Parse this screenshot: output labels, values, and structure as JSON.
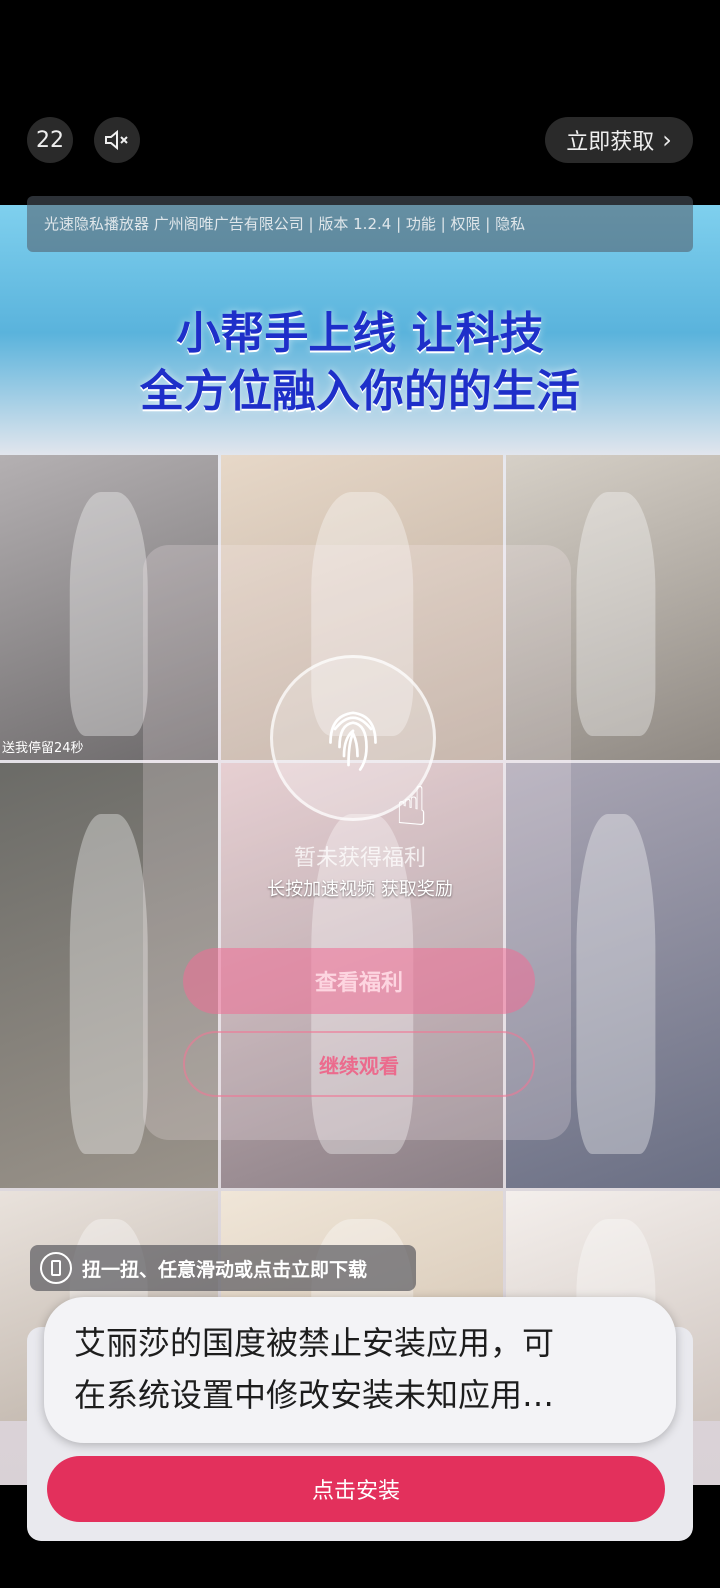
{
  "topbar": {
    "countdown": "22",
    "get_now_label": "立即获取",
    "get_now_chevron": "›"
  },
  "info_bar": {
    "text": "光速隐私播放器 广州阁唯广告有限公司 | 版本 1.2.4 | 功能 | 权限 | 隐私"
  },
  "ad": {
    "headline_line1": "小帮手上线 让科技",
    "headline_line2": "全方位融入你的的生活",
    "cell_caption": "送我停留24秒",
    "overlay_status": "暂未获得福利",
    "overlay_hint": "长按加速视频 获取奖励",
    "view_benefit_label": "查看福利",
    "continue_label": "继续观看",
    "tip_text": "扭一扭、任意滑动或点击立即下载"
  },
  "toast": {
    "line1": "艾丽莎的国度被禁止安装应用，可",
    "line2": "在系统设置中修改安装未知应用…"
  },
  "install_button_label": "点击安装",
  "icons": {
    "mute": "speaker-muted-icon",
    "fingerprint": "fingerprint-icon",
    "hand": "pointing-hand-icon",
    "phone": "phone-shake-icon"
  },
  "colors": {
    "install_button": "#e3305c",
    "headline": "#1e2fc9"
  }
}
